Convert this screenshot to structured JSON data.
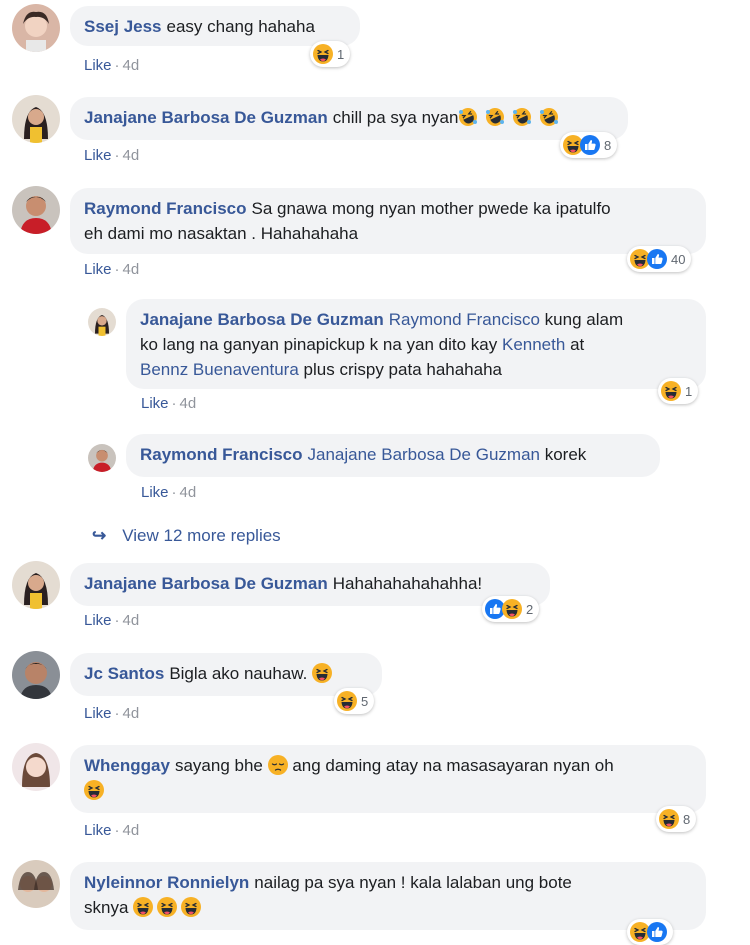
{
  "common": {
    "like": "Like",
    "sep": "·",
    "time": "4d"
  },
  "comments": [
    {
      "name": "Ssej Jess",
      "text": "easy chang hahaha",
      "count": "1"
    },
    {
      "name": "Janajane Barbosa De Guzman",
      "text": "chill pa sya nyan",
      "count": "8"
    },
    {
      "name": "Raymond Francisco",
      "text_line1": "Sa gnawa mong nyan mother pwede ka ipatulfo",
      "text_line2": "eh dami mo nasaktan . Hahahahaha",
      "count": "40"
    },
    {
      "name": "Janajane Barbosa De Guzman",
      "mention1": "Raymond Francisco",
      "text1": "kung alam",
      "text2": "ko lang na ganyan pinapickup k na yan dito kay",
      "mention2": "Kenneth",
      "text3": "at",
      "mention3": "Bennz Buenaventura",
      "text4": "plus crispy pata hahahaha",
      "count": "1"
    },
    {
      "name": "Raymond Francisco",
      "mention": "Janajane Barbosa De Guzman",
      "text": "korek"
    },
    {
      "name": "Janajane Barbosa De Guzman",
      "text": "Hahahahahahahha!",
      "count": "2"
    },
    {
      "name": "Jc Santos",
      "text": "Bigla ako nauhaw.",
      "count": "5"
    },
    {
      "name": "Whenggay",
      "text_a": "sayang bhe",
      "text_b": "ang daming atay na masasayaran nyan oh",
      "count": "8"
    },
    {
      "name": "Nyleinnor Ronnielyn",
      "text_line1": "nailag pa sya nyan ! kala lalaban ung bote",
      "text_line2": "sknya"
    }
  ],
  "view_more": "View 12 more replies",
  "icons": {
    "haha": "haha-emoji",
    "like": "like-reaction-icon",
    "rofl": "rofl-emoji",
    "pensive": "pensive-emoji",
    "reply_arrow": "reply-arrow-icon"
  },
  "colors": {
    "name": "#385898",
    "bubble": "#f2f3f5",
    "emoji": "#f7b125",
    "like_blue": "#1877f2"
  }
}
